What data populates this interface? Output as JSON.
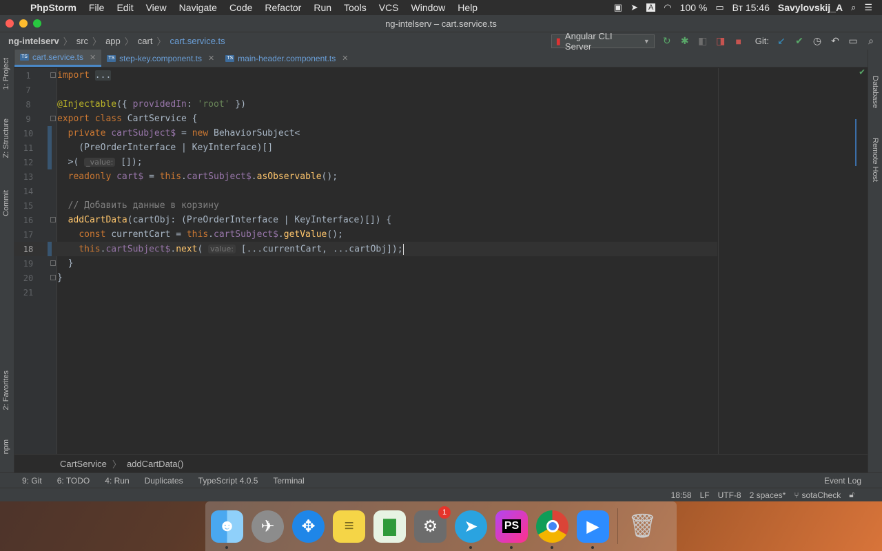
{
  "menubar": {
    "app_name": "PhpStorm",
    "items": [
      "File",
      "Edit",
      "View",
      "Navigate",
      "Code",
      "Refactor",
      "Run",
      "Tools",
      "VCS",
      "Window",
      "Help"
    ],
    "battery": "100 %",
    "clock": "Вт 15:46",
    "user": "Savylovskij_A",
    "input_lang": "A"
  },
  "window": {
    "title": "ng-intelserv – cart.service.ts"
  },
  "navbar": {
    "crumbs": [
      "ng-intelserv",
      "src",
      "app",
      "cart",
      "cart.service.ts"
    ],
    "run_config": "Angular CLI Server",
    "git_label": "Git:"
  },
  "left_tabs": [
    "1: Project",
    "Z: Structure",
    "Commit",
    "2: Favorites",
    "npm"
  ],
  "right_tabs": [
    "Database",
    "Remote Host"
  ],
  "tabs": [
    {
      "label": "cart.service.ts",
      "active": true
    },
    {
      "label": "step-key.component.ts",
      "active": false
    },
    {
      "label": "main-header.component.ts",
      "active": false
    }
  ],
  "code": {
    "line_numbers": [
      "1",
      "7",
      "8",
      "9",
      "10",
      "11",
      "12",
      "13",
      "14",
      "15",
      "16",
      "17",
      "18",
      "19",
      "20",
      "21"
    ],
    "current_line": "18",
    "hint_value1": "_value:",
    "hint_value2": "value:"
  },
  "editor_breadcrumbs": [
    "CartService",
    "addCartData()"
  ],
  "tool_windows": [
    "9: Git",
    "6: TODO",
    "4: Run",
    "Duplicates",
    "TypeScript 4.0.5",
    "Terminal"
  ],
  "event_log": "Event Log",
  "status": {
    "position": "18:58",
    "line_sep": "LF",
    "encoding": "UTF-8",
    "indent": "2 spaces*",
    "branch": "sotaCheck"
  },
  "dock": {
    "apps": [
      "Finder",
      "Launchpad",
      "Safari",
      "Notes",
      "Numbers",
      "System Preferences",
      "Telegram",
      "PhpStorm",
      "Chrome",
      "Zoom",
      "Trash"
    ],
    "sysprefs_badge": "1"
  }
}
